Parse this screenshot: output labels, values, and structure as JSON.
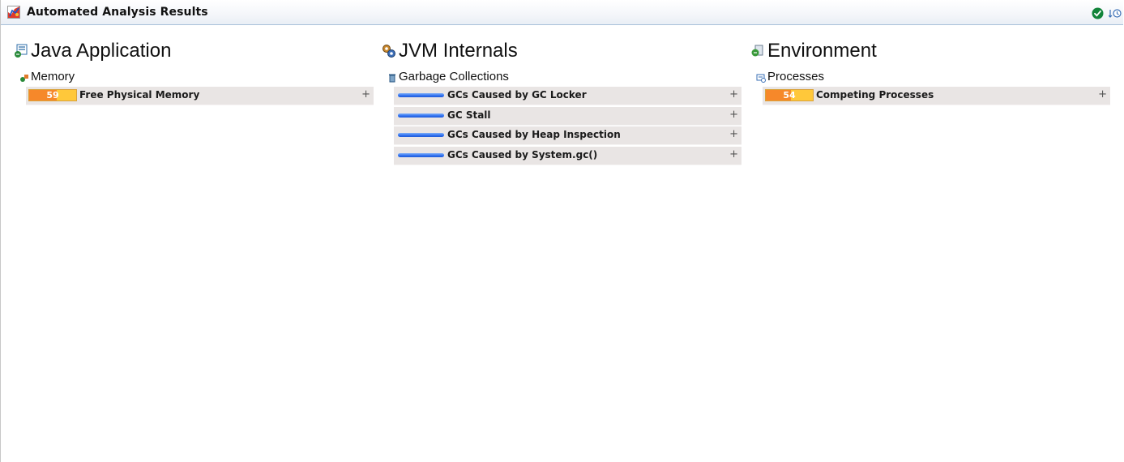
{
  "window": {
    "title": "Automated Analysis Results"
  },
  "columns": [
    {
      "title": "Java Application",
      "icon": "java-application-icon",
      "sections": [
        {
          "title": "Memory",
          "icon": "memory-icon",
          "rows": [
            {
              "label": "Free Physical Memory",
              "score": "59",
              "score_fraction": 0.59
            }
          ]
        }
      ]
    },
    {
      "title": "JVM Internals",
      "icon": "jvm-internals-icon",
      "sections": [
        {
          "title": "Garbage Collections",
          "icon": "trash-icon",
          "rows": [
            {
              "label": "GCs Caused by GC Locker",
              "status": "ok"
            },
            {
              "label": "GC Stall",
              "status": "ok"
            },
            {
              "label": "GCs Caused by Heap Inspection",
              "status": "ok"
            },
            {
              "label": "GCs Caused by System.gc()",
              "status": "ok"
            }
          ]
        }
      ]
    },
    {
      "title": "Environment",
      "icon": "environment-icon",
      "sections": [
        {
          "title": "Processes",
          "icon": "processes-icon",
          "rows": [
            {
              "label": "Competing Processes",
              "score": "54",
              "score_fraction": 0.54
            }
          ]
        }
      ]
    }
  ],
  "expand_symbol": "+",
  "colors": {
    "warning_fill": "#f6882a",
    "warning_bg": "#ffc83a",
    "ok_bar": "#2f6ff0",
    "row_bg": "#e9e5e4"
  }
}
